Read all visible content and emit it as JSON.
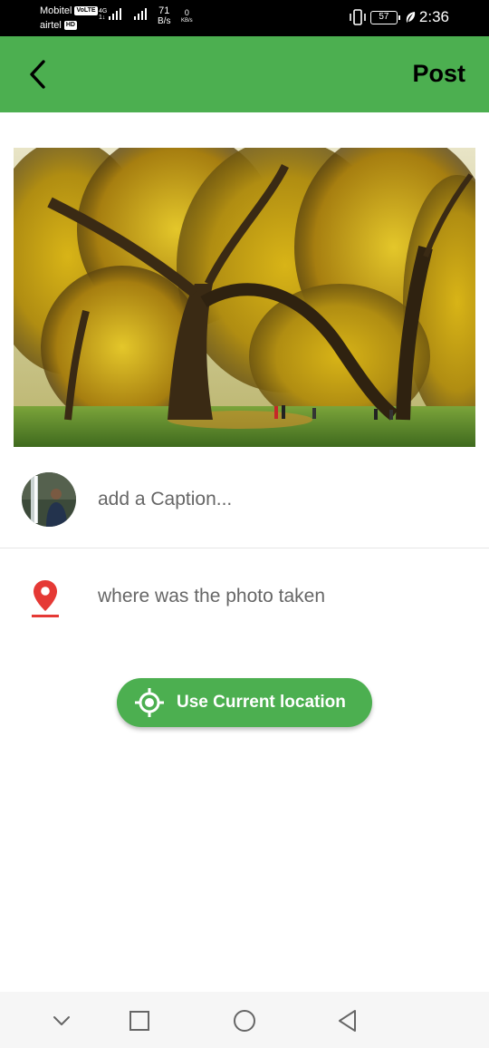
{
  "status_bar": {
    "carrier1": "Mobitel",
    "carrier1_badge": "VoLTE",
    "carrier2": "airtel",
    "carrier2_badge": "HD",
    "network_type": "4G",
    "network_sub": "1↓",
    "speed_value": "71",
    "speed_unit": "B/s",
    "kbs_value": "0",
    "kbs_unit": "KB/s",
    "battery": "57",
    "time": "2:36",
    "icons": [
      "vibrate-icon",
      "battery-icon",
      "leaf-icon",
      "signal-icon"
    ]
  },
  "app_bar": {
    "back_icon": "arrow-back-icon",
    "post_label": "Post",
    "color": "#4caf50"
  },
  "photo": {
    "subject": "tree-photo"
  },
  "caption": {
    "placeholder": "add a Caption...",
    "value": ""
  },
  "location": {
    "icon": "map-pin-icon",
    "icon_color": "#e53935",
    "placeholder": "where was the photo taken",
    "value": ""
  },
  "use_location_button": {
    "icon": "gps-target-icon",
    "label": "Use Current location"
  },
  "nav_bar": {
    "icons": [
      "chevron-down-icon",
      "square-icon",
      "circle-icon",
      "triangle-back-icon"
    ]
  }
}
